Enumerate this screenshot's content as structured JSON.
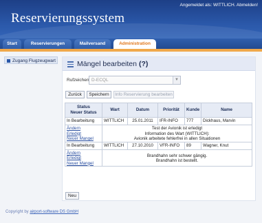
{
  "header": {
    "app_title": "Reservierungssystem",
    "login_prefix": "Angemeldet als: WITTLICH.",
    "logout_label": "Abmelden!"
  },
  "nav": {
    "tabs": [
      {
        "label": "Start",
        "active": false
      },
      {
        "label": "Reservierungen",
        "active": false
      },
      {
        "label": "Mailversand",
        "active": false
      },
      {
        "label": "Administration",
        "active": true
      }
    ]
  },
  "sidebar": {
    "items": [
      {
        "label": "Zugang Flugzeugwart"
      }
    ]
  },
  "main": {
    "title": "Mängel bearbeiten",
    "help": "(?)",
    "field_label": "Rufzeichen",
    "callsign_value": "D-ECQL",
    "buttons": {
      "back": "Zurück",
      "save": "Speichern",
      "info": "Info Reservierung bearbeiten"
    },
    "table": {
      "headers": {
        "status": "Status",
        "new_status": "Neuer Status",
        "wart": "Wart",
        "datum": "Datum",
        "prioritaet": "Priorität",
        "kunde": "Kunde",
        "name": "Name"
      },
      "rows": [
        {
          "status": "In Bearbeitung",
          "wart": "WITTLICH",
          "datum": "25.01.2011",
          "prioritaet": "IFR-INFO",
          "kunde": "777",
          "name": "Dickhaus, Marvin",
          "actions": [
            "Ändern",
            "Erledigt",
            "Neuer Mangel"
          ],
          "remarks": [
            "Test der Avionik ist erledigt",
            "Information des Wart (WITTLICH):",
            "Avionik arbeitete fehlerfrei in allen Situationen"
          ]
        },
        {
          "status": "In Bearbeitung",
          "wart": "WITTLICH",
          "datum": "27.10.2010",
          "prioritaet": "VFR-INFO",
          "kunde": "89",
          "name": "Wagner, Knut",
          "actions": [
            "Ändern",
            "Erledigt",
            "Neuer Mangel"
          ],
          "remarks": [
            "Brandhahn sehr schwer gängig.",
            "Brandhahn ist bestellt."
          ]
        }
      ]
    },
    "new_button": "Neu"
  },
  "footer": {
    "prefix": "Copyright by ",
    "link": "airport-software DS GmbH"
  },
  "colors": {
    "header_blue": "#2a57a8",
    "active_tab_text": "#e0761a",
    "accent_strip": "#f0a84a"
  }
}
